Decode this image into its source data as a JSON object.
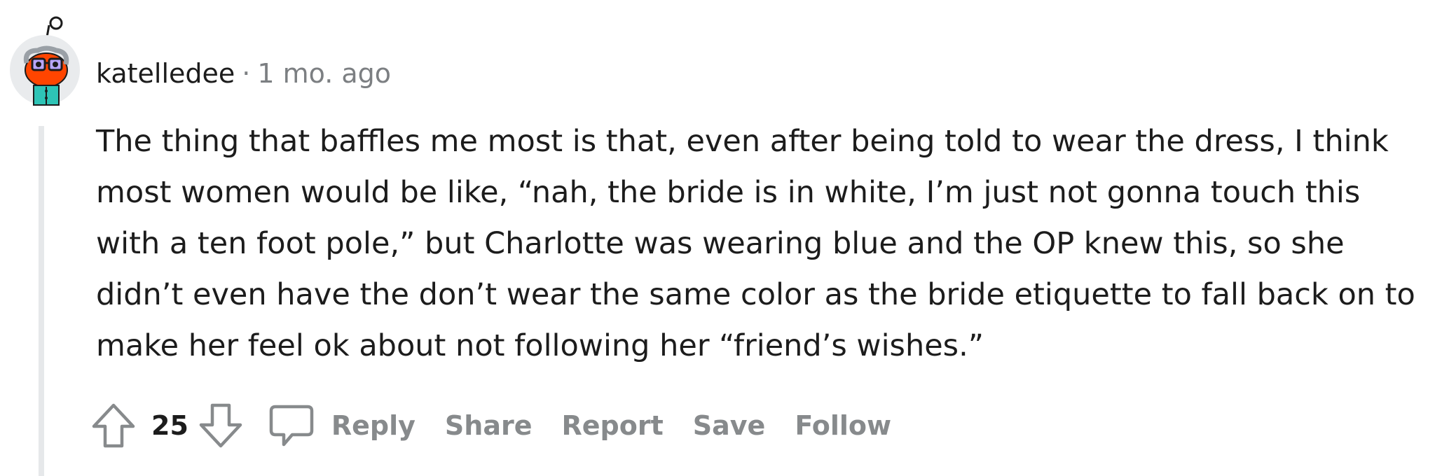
{
  "comment": {
    "author": "katelledee",
    "separator": "·",
    "timestamp": "1 mo. ago",
    "body": "The thing that baffles me most is that, even after being told to wear the dress, I think most women would be like, “nah, the bride is in white, I’m just not gonna touch this with a ten foot pole,” but Charlotte was wearing blue and the OP knew this, so she didn’t even have the don’t wear the same color as the bride etiquette to fall back on to make her feel ok about not following her “friend’s wishes.”"
  },
  "actions": {
    "vote_count": "25",
    "reply": "Reply",
    "share": "Share",
    "report": "Report",
    "save": "Save",
    "follow": "Follow"
  },
  "icons": {
    "avatar": "snoo-avatar",
    "upvote": "arrow-up-icon",
    "downvote": "arrow-down-icon",
    "reply": "speech-bubble-icon"
  },
  "colors": {
    "text": "#1c1c1c",
    "meta": "#7c7f82",
    "action": "#878a8c",
    "thread_line": "#e6e8ea",
    "avatar_orange": "#ff4500",
    "avatar_teal": "#2ec4b6"
  }
}
